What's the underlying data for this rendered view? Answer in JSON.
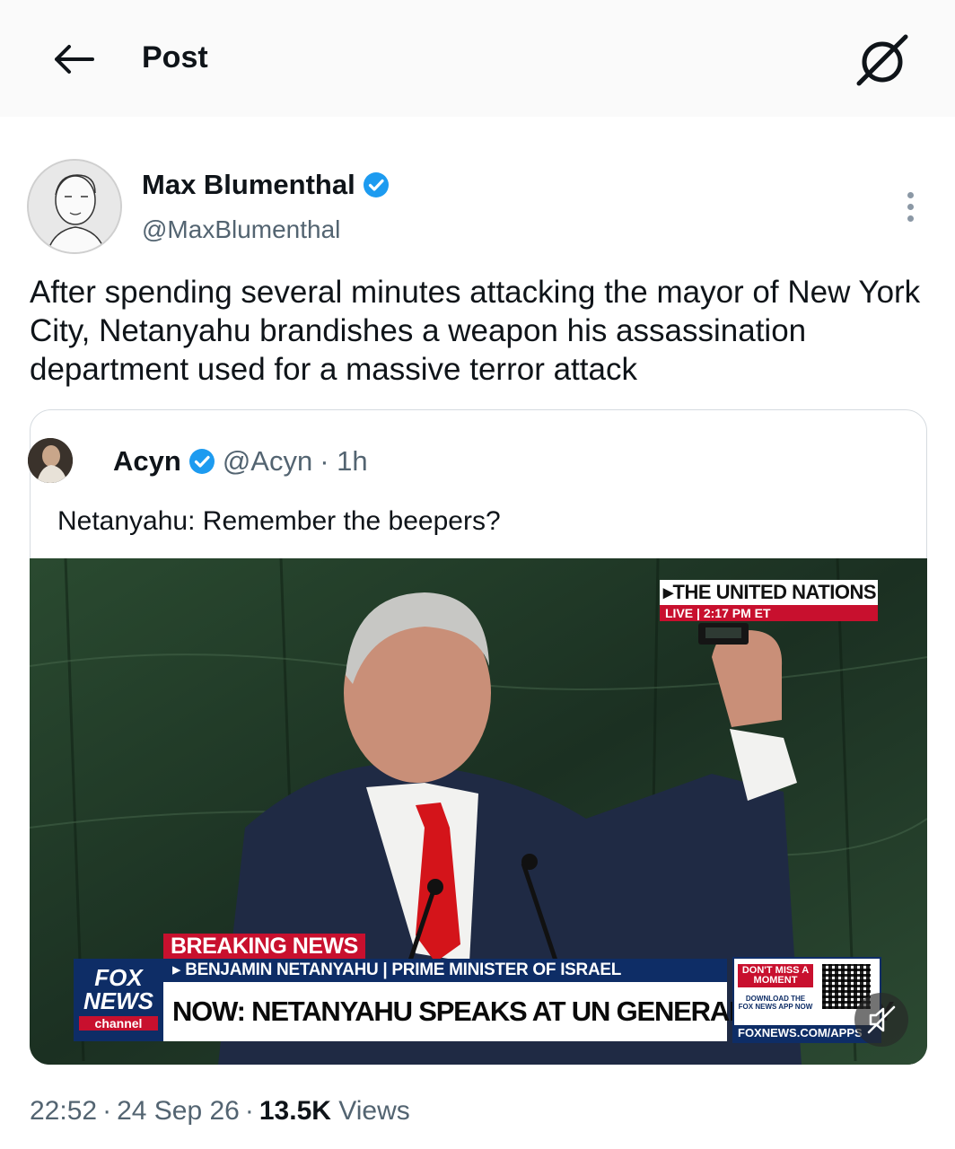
{
  "header": {
    "title": "Post",
    "back_icon": "arrow-left-icon",
    "grok_icon": "grok-icon"
  },
  "author": {
    "name": "Max Blumenthal",
    "handle": "@MaxBlumenthal",
    "verified": true,
    "verified_color": "#1d9bf0"
  },
  "post": {
    "text": "After spending several minutes attacking the mayor of New York City, Netanyahu brandishes a weapon his assassination department used for a massive terror attack"
  },
  "quote": {
    "name": "Acyn",
    "handle": "@Acyn",
    "time": "· 1h",
    "text": "Netanyahu: Remember the beepers?"
  },
  "video": {
    "un_tag": "▸THE UNITED NATIONS",
    "live_label": "LIVE",
    "live_time": "2:17 PM ET",
    "breaking": "BREAKING NEWS",
    "name_bar": "▸ BENJAMIN NETANYAHU | PRIME MINISTER OF ISRAEL",
    "headline": "NOW: NETANYAHU SPEAKS AT UN GENERAL ASSEMBLY",
    "logo_line1": "FOX",
    "logo_line2": "NEWS",
    "logo_line3": "channel",
    "promo_line1": "DON'T MISS A MOMENT",
    "promo_line2": "DOWNLOAD THE FOX NEWS APP NOW",
    "promo_url": "FOXNEWS.COM/APPS",
    "muted": true
  },
  "meta": {
    "time": "22:52",
    "date": "24 Sep 26",
    "views_count": "13.5K",
    "views_label": "Views"
  }
}
